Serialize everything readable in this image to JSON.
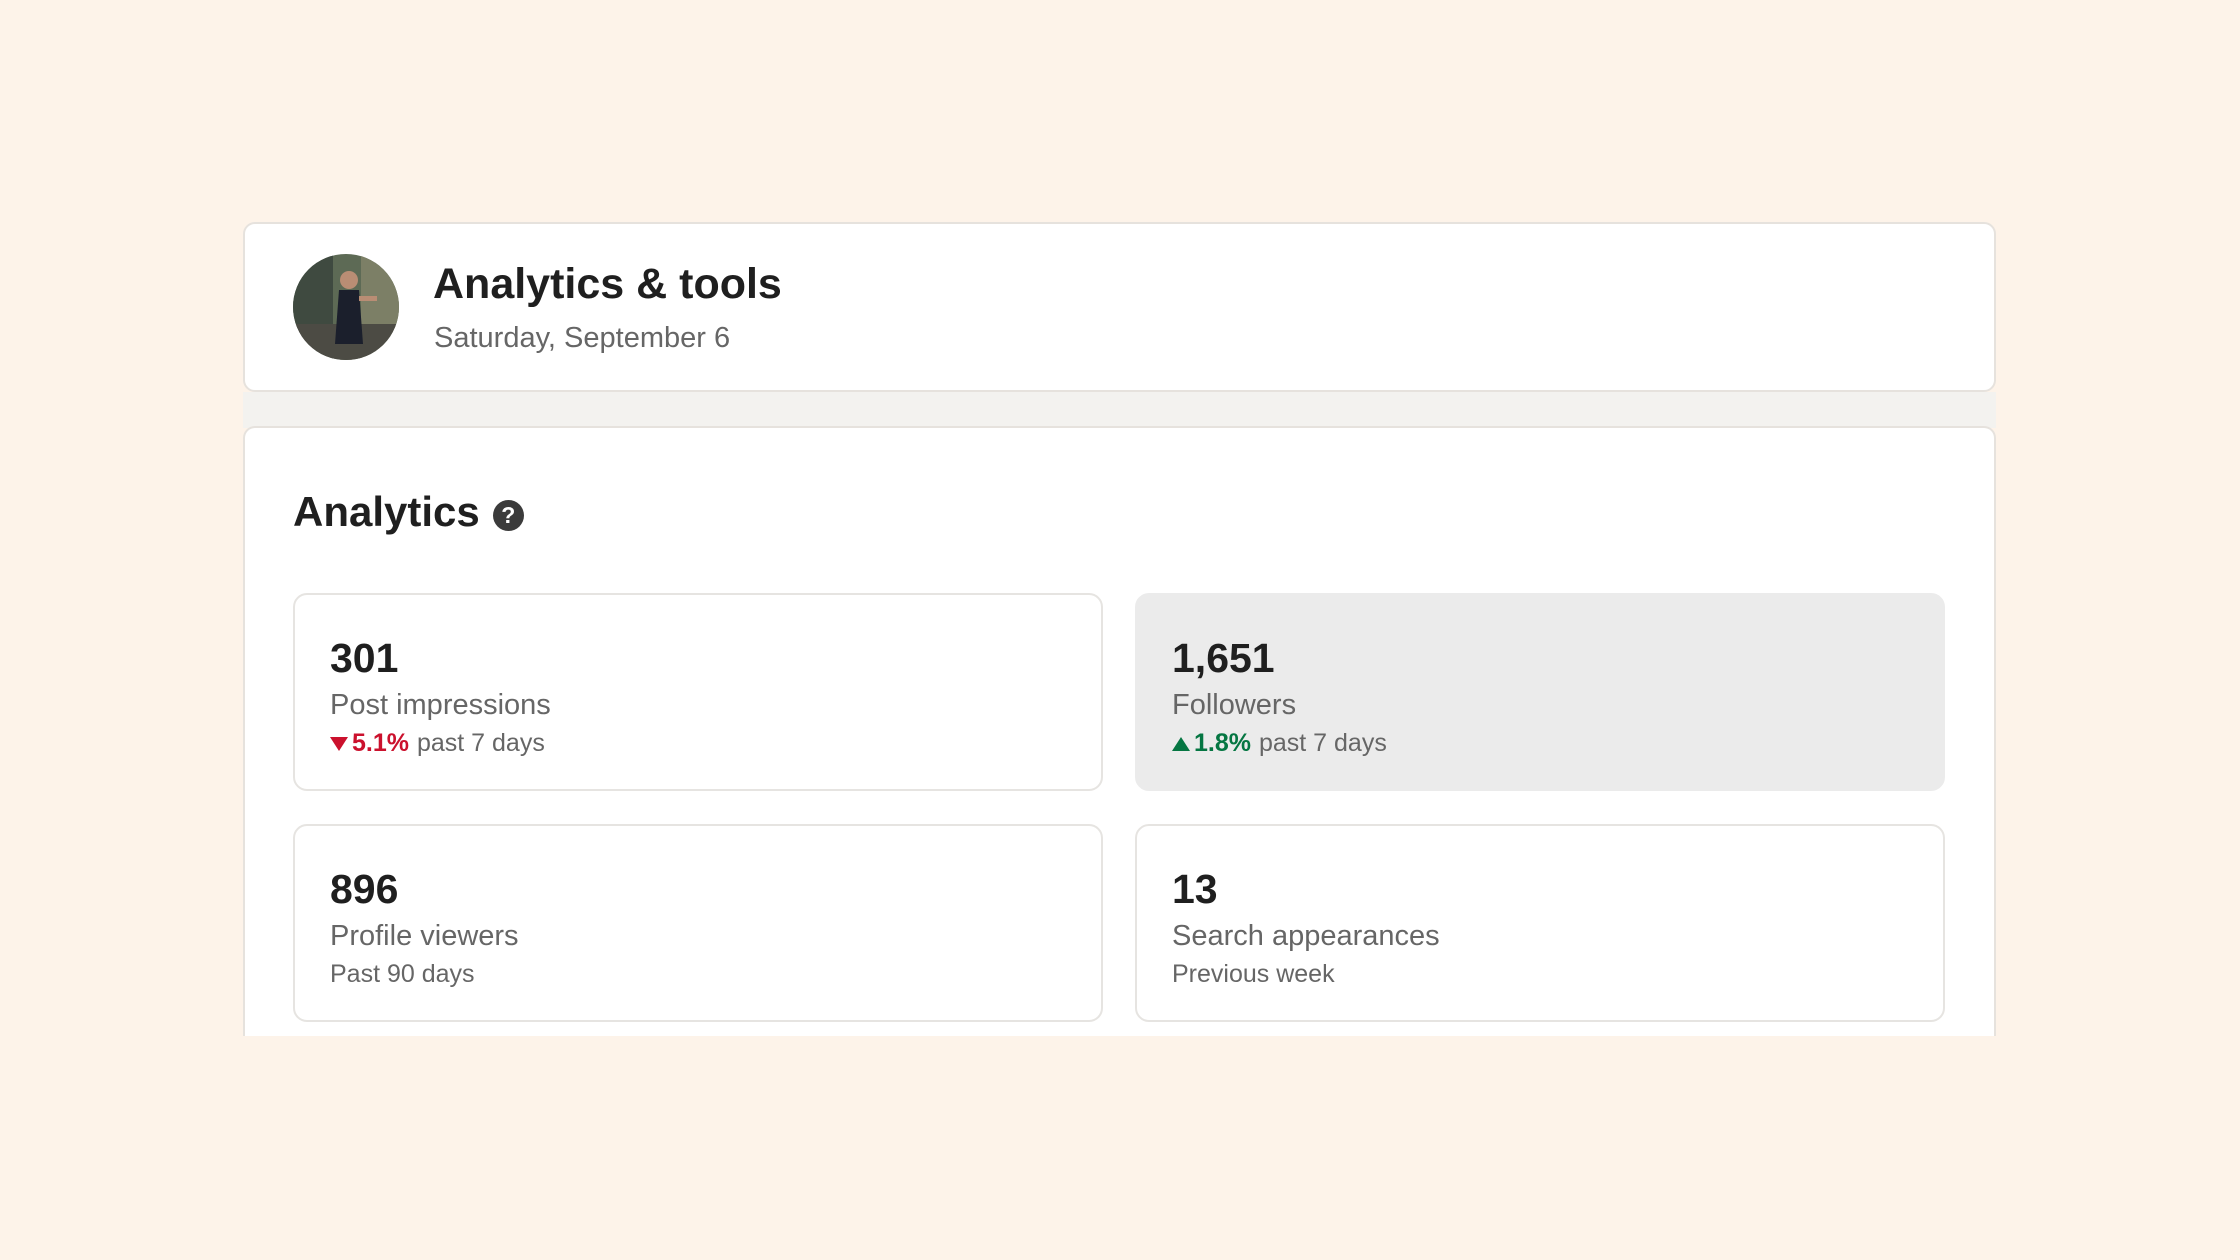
{
  "header": {
    "title": "Analytics & tools",
    "date": "Saturday, September 6"
  },
  "analytics": {
    "title": "Analytics",
    "metrics": [
      {
        "value": "301",
        "label": "Post impressions",
        "change": "5.1%",
        "direction": "down",
        "period": "past 7 days"
      },
      {
        "value": "1,651",
        "label": "Followers",
        "change": "1.8%",
        "direction": "up",
        "period": "past 7 days"
      },
      {
        "value": "896",
        "label": "Profile viewers",
        "period": "Past 90 days"
      },
      {
        "value": "13",
        "label": "Search appearances",
        "period": "Previous week"
      }
    ]
  },
  "colors": {
    "page_background": "#fdf3e9",
    "negative": "#cb112d",
    "positive": "#057642",
    "selected_card": "#ebebeb"
  },
  "icons": {
    "help": "question-circle-icon",
    "trend_down": "triangle-down-icon",
    "trend_up": "triangle-up-icon"
  }
}
